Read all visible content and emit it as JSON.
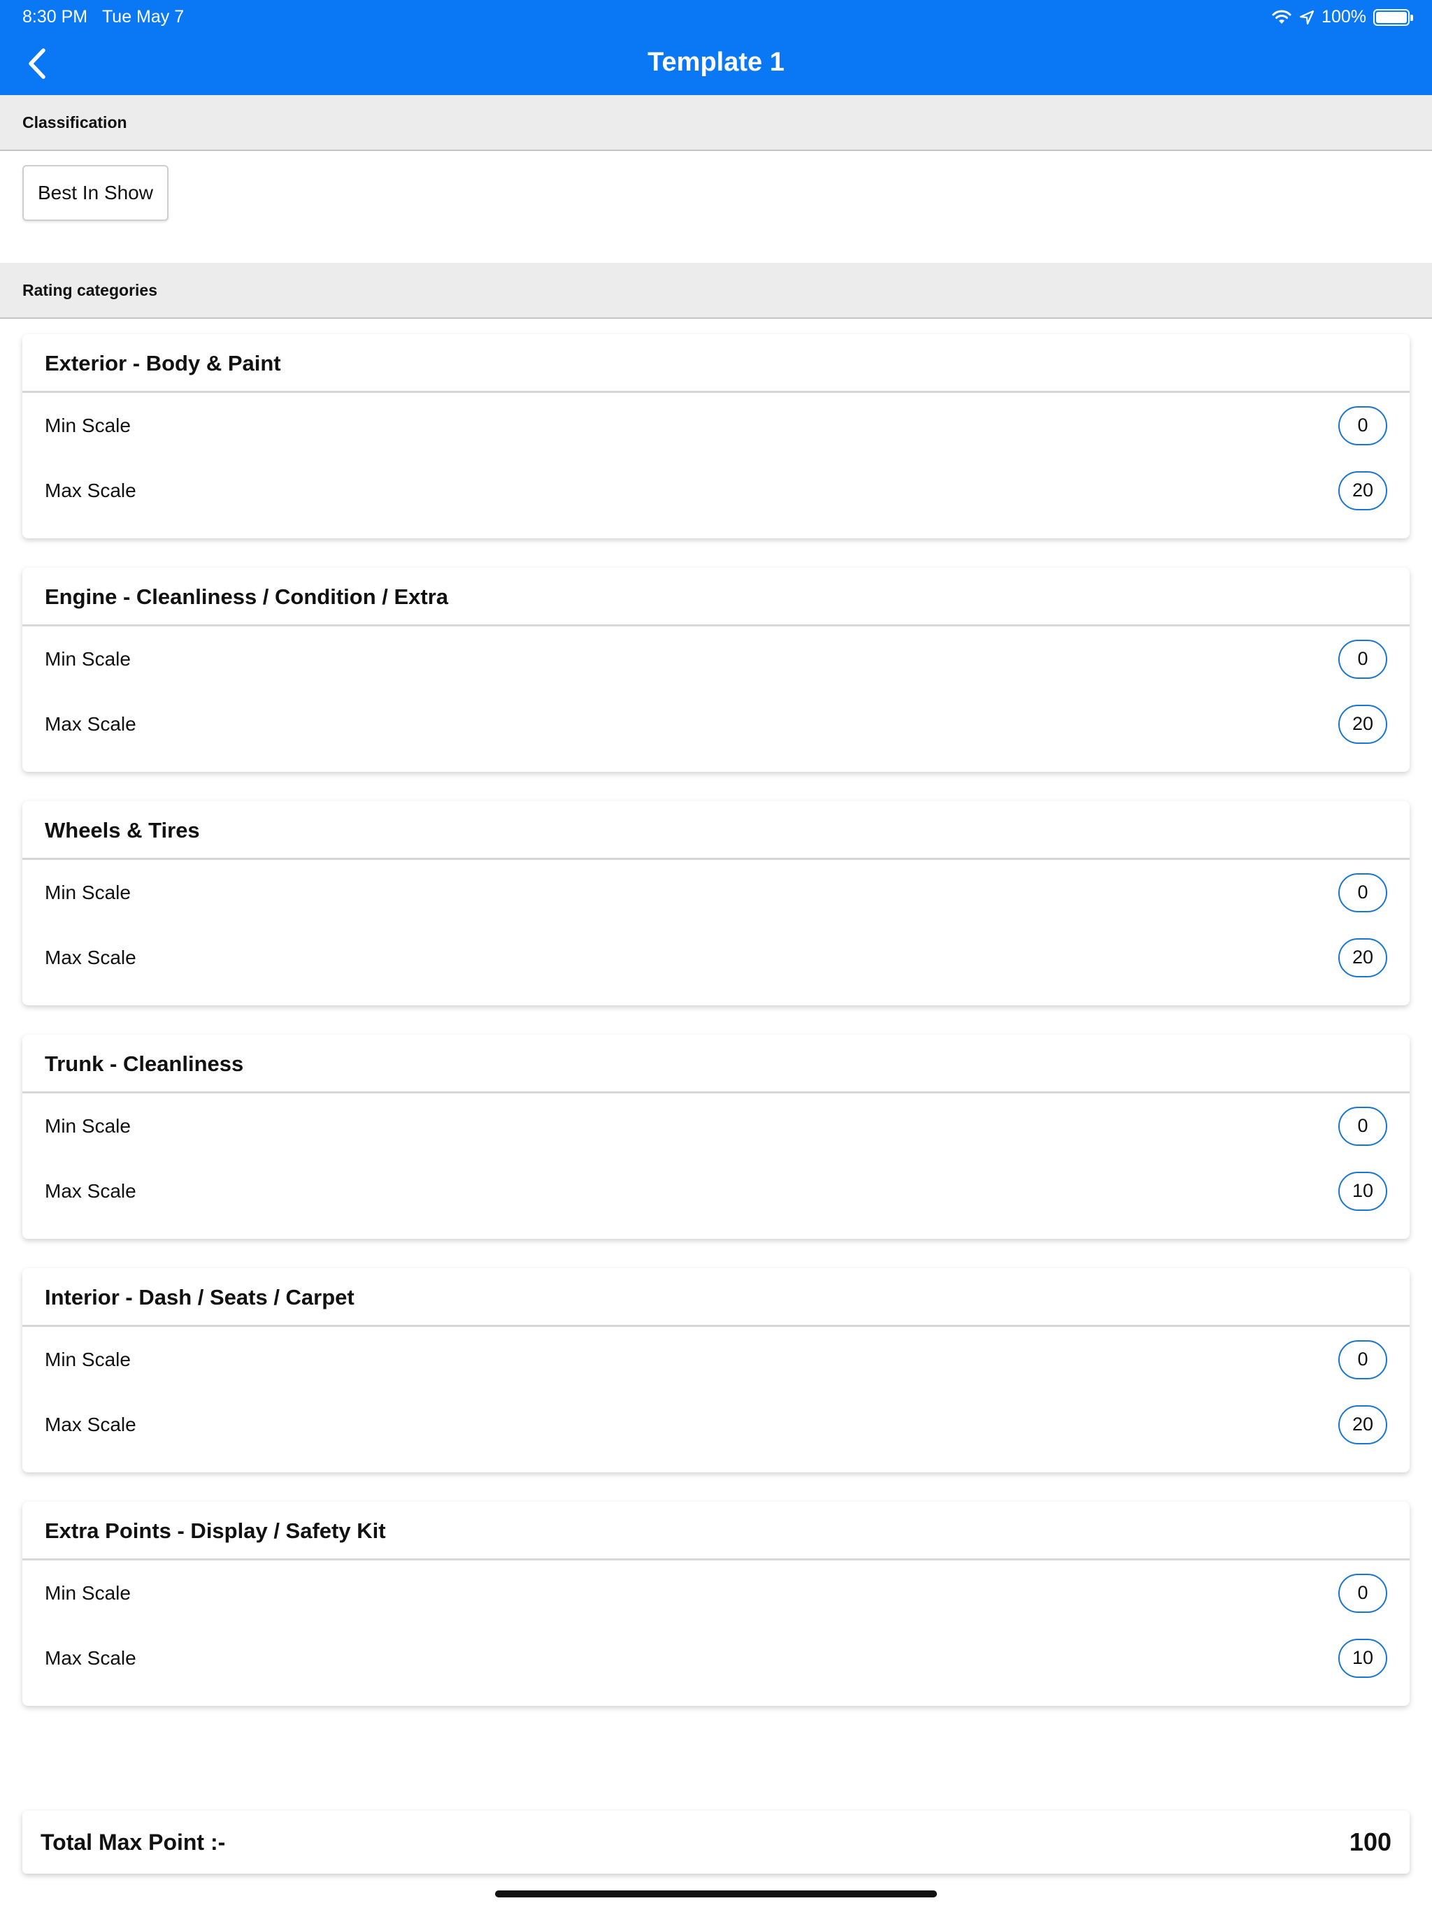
{
  "status_bar": {
    "time": "8:30 PM",
    "date": "Tue May 7",
    "battery": "100%"
  },
  "nav": {
    "title": "Template 1"
  },
  "classification": {
    "header": "Classification",
    "chip": "Best In Show"
  },
  "rating": {
    "header": "Rating categories",
    "categories": [
      {
        "title": "Exterior - Body & Paint",
        "min_label": "Min Scale",
        "min": "0",
        "max_label": "Max Scale",
        "max": "20"
      },
      {
        "title": "Engine - Cleanliness / Condition / Extra",
        "min_label": "Min Scale",
        "min": "0",
        "max_label": "Max Scale",
        "max": "20"
      },
      {
        "title": "Wheels & Tires",
        "min_label": "Min Scale",
        "min": "0",
        "max_label": "Max Scale",
        "max": "20"
      },
      {
        "title": "Trunk - Cleanliness",
        "min_label": "Min Scale",
        "min": "0",
        "max_label": "Max Scale",
        "max": "10"
      },
      {
        "title": "Interior - Dash / Seats / Carpet",
        "min_label": "Min Scale",
        "min": "0",
        "max_label": "Max Scale",
        "max": "20"
      },
      {
        "title": "Extra Points - Display / Safety Kit",
        "min_label": "Min Scale",
        "min": "0",
        "max_label": "Max Scale",
        "max": "10"
      }
    ]
  },
  "total": {
    "label": "Total Max Point :-",
    "value": "100"
  },
  "colors": {
    "header_blue": "#0a78f5",
    "pill_border": "#1976d2"
  },
  "icons": {
    "back": "chevron-left-icon",
    "wifi": "wifi-icon",
    "location": "location-arrow-icon",
    "battery": "battery-icon"
  }
}
